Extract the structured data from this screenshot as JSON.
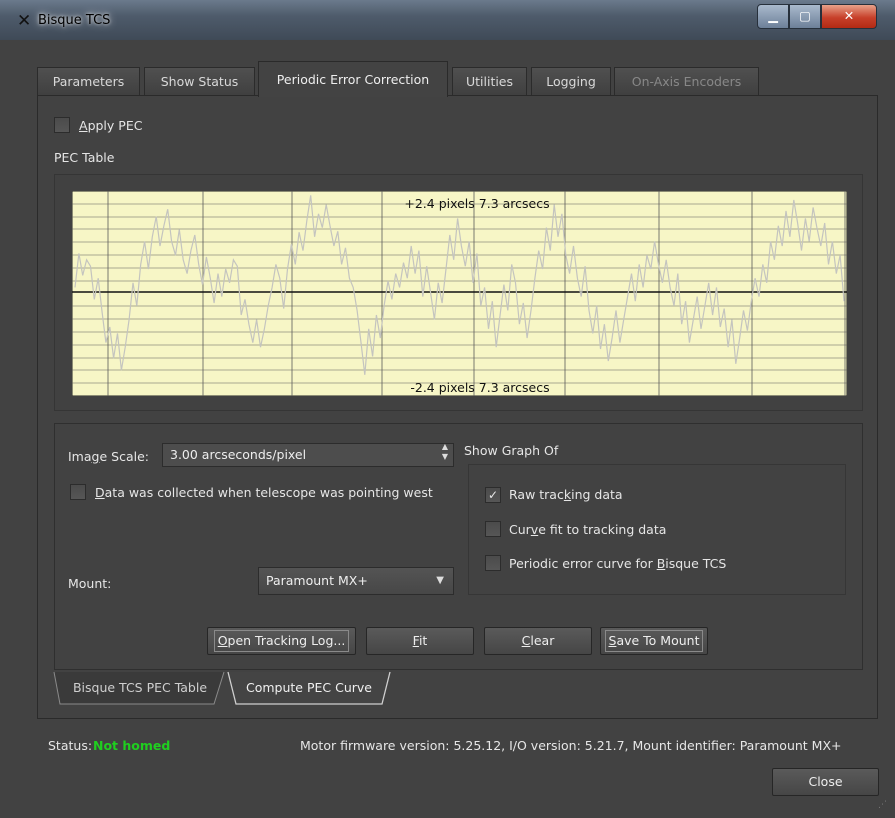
{
  "window": {
    "title": "Bisque TCS",
    "app_icon": "x-logo-icon"
  },
  "tabs": [
    {
      "label": "Parameters",
      "state": "normal"
    },
    {
      "label": "Show Status",
      "state": "normal"
    },
    {
      "label": "Periodic Error Correction",
      "state": "active"
    },
    {
      "label": "Utilities",
      "state": "normal"
    },
    {
      "label": "Logging",
      "state": "normal"
    },
    {
      "label": "On-Axis Encoders",
      "state": "disabled"
    }
  ],
  "pec": {
    "apply_label": "Apply PEC",
    "apply_checked": false,
    "table_label": "PEC Table",
    "top_annotation": "+2.4  pixels  7.3 arcsecs",
    "bottom_annotation": "-2.4  pixels  7.3 arcsecs",
    "trace_values": [
      0.05,
      0.42,
      0.18,
      0.35,
      0.28,
      -0.08,
      0.15,
      -0.22,
      -0.55,
      -0.38,
      -0.72,
      -0.45,
      -0.85,
      -0.6,
      -0.3,
      0.1,
      -0.15,
      0.3,
      0.55,
      0.25,
      0.6,
      0.82,
      0.5,
      0.72,
      0.9,
      0.55,
      0.4,
      0.68,
      0.35,
      0.2,
      0.45,
      0.62,
      0.3,
      0.08,
      0.38,
      0.15,
      -0.12,
      0.2,
      -0.05,
      0.25,
      0.1,
      0.35,
      0.28,
      -0.25,
      -0.08,
      -0.35,
      -0.55,
      -0.3,
      -0.6,
      -0.4,
      -0.15,
      0.05,
      0.3,
      0.15,
      -0.18,
      0.25,
      0.52,
      0.3,
      0.65,
      0.45,
      0.78,
      1.05,
      0.6,
      0.85,
      0.7,
      0.95,
      0.72,
      0.5,
      0.66,
      0.3,
      0.48,
      0.15,
      0.05,
      -0.2,
      -0.55,
      -0.9,
      -0.4,
      -0.7,
      -0.25,
      -0.5,
      -0.15,
      0.12,
      -0.08,
      0.2,
      0.05,
      0.32,
      0.15,
      0.5,
      0.2,
      0.45,
      -0.05,
      0.28,
      0.0,
      -0.3,
      0.1,
      -0.12,
      0.25,
      0.62,
      0.35,
      0.8,
      0.5,
      0.28,
      0.55,
      0.1,
      0.42,
      -0.15,
      0.05,
      -0.4,
      -0.1,
      -0.6,
      -0.25,
      0.08,
      -0.2,
      0.3,
      0.1,
      -0.35,
      -0.12,
      -0.5,
      -0.2,
      0.15,
      0.45,
      0.25,
      0.7,
      0.45,
      0.95,
      0.6,
      0.85,
      0.4,
      0.2,
      0.5,
      0.15,
      -0.05,
      0.28,
      -0.2,
      -0.45,
      -0.15,
      -0.62,
      -0.35,
      -0.75,
      -0.5,
      -0.2,
      -0.55,
      -0.3,
      -0.05,
      0.2,
      -0.1,
      0.3,
      0.05,
      0.4,
      0.25,
      0.55,
      0.3,
      0.1,
      0.35,
      0.05,
      -0.15,
      0.2,
      -0.35,
      -0.1,
      -0.55,
      -0.3,
      -0.05,
      -0.4,
      -0.15,
      0.1,
      -0.25,
      0.05,
      -0.38,
      -0.18,
      -0.6,
      -0.3,
      -0.78,
      -0.5,
      -0.2,
      -0.42,
      -0.1,
      0.15,
      -0.05,
      0.3,
      0.1,
      0.55,
      0.35,
      0.72,
      0.5,
      0.88,
      0.6,
      1.0,
      0.75,
      0.45,
      0.8,
      0.55,
      0.92,
      0.7,
      0.5,
      0.75,
      0.3,
      0.55,
      0.2,
      0.4,
      -0.1
    ]
  },
  "image_scale": {
    "label": "Image Scale:",
    "value": "3.00 arcseconds/pixel"
  },
  "west": {
    "label": "Data was collected when telescope was pointing west",
    "checked": false
  },
  "show_graph": {
    "title": "Show Graph Of",
    "options": [
      {
        "label": "Raw tracking data",
        "checked": true
      },
      {
        "label": "Curve fit to tracking data",
        "checked": false
      },
      {
        "label": "Periodic error curve for Bisque TCS",
        "checked": false
      }
    ]
  },
  "mount": {
    "label": "Mount:",
    "value": "Paramount MX+"
  },
  "buttons": {
    "open_log": "Open Tracking Log...",
    "fit": "Fit",
    "clear": "Clear",
    "save": "Save To Mount"
  },
  "bottom_tabs": {
    "table": "Bisque TCS PEC Table",
    "compute": "Compute PEC Curve"
  },
  "status": {
    "label": "Status:",
    "value": "Not homed",
    "firmware": "Motor firmware version: 5.25.12, I/O version: 5.21.7, Mount identifier: Paramount MX+"
  },
  "close_label": "Close",
  "colors": {
    "plot_bg": "#f7f6c6",
    "status_ok": "#1fcf1f",
    "trace": "#c4c4bf"
  }
}
